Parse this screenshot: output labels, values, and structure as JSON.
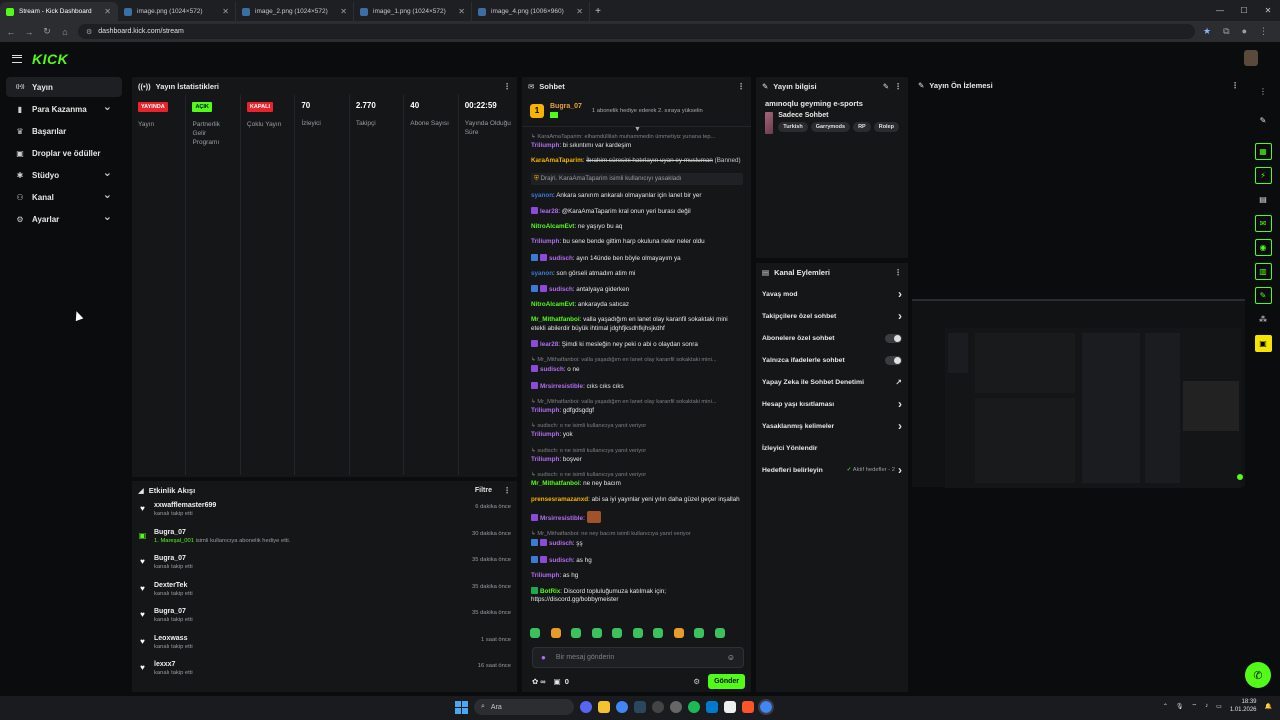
{
  "browser": {
    "tabs": [
      {
        "label": "Stream - Kick Dashboard",
        "active": true
      },
      {
        "label": "image.png (1024×572)"
      },
      {
        "label": "image_2.png (1024×572)"
      },
      {
        "label": "image_1.png (1024×572)"
      },
      {
        "label": "image_4.png (1006×960)"
      }
    ],
    "url": "dashboard.kick.com/stream"
  },
  "brand": {
    "logo": "KICK",
    "accent": "#53fc18"
  },
  "sidebar": {
    "items": [
      {
        "label": "Yayın",
        "icon": "broadcast-icon",
        "active": true
      },
      {
        "label": "Para Kazanma",
        "icon": "money-icon",
        "expandable": true
      },
      {
        "label": "Başarılar",
        "icon": "trophy-icon"
      },
      {
        "label": "Droplar ve ödüller",
        "icon": "gift-icon"
      },
      {
        "label": "Stüdyo",
        "icon": "studio-icon",
        "expandable": true
      },
      {
        "label": "Kanal",
        "icon": "channel-icon",
        "expandable": true
      },
      {
        "label": "Ayarlar",
        "icon": "gear-icon",
        "expandable": true
      }
    ]
  },
  "stats": {
    "title": "Yayın İstatistikleri",
    "columns": [
      {
        "badge": "YAYINDA",
        "badge_color": "red",
        "label": "Yayın"
      },
      {
        "badge": "AÇIK",
        "badge_color": "green",
        "label": "Partnerlik Gelir Programı"
      },
      {
        "badge": "KAPALI",
        "badge_color": "red",
        "label": "Çoklu Yayın"
      },
      {
        "value": "70",
        "label": "İzleyici"
      },
      {
        "value": "2.770",
        "label": "Takipçi"
      },
      {
        "value": "40",
        "label": "Abone Sayısı"
      },
      {
        "value": "00:22:59",
        "label": "Yayında Olduğu Süre"
      }
    ]
  },
  "activity": {
    "title": "Etkinlik Akışı",
    "filter_label": "Filtre",
    "items": [
      {
        "name": "xxwafflemaster699",
        "sub": "kanalı takip etti",
        "time": "6 dakika önce",
        "icon": "heart-icon"
      },
      {
        "name": "Bugra_07",
        "sub_highlight": "1. Mareşal_001",
        "sub": " isimli kullanıcıya abonelik hediye etti.",
        "time": "30 dakika önce",
        "icon": "gift-icon"
      },
      {
        "name": "Bugra_07",
        "sub": "kanalı takip etti",
        "time": "35 dakika önce",
        "icon": "heart-icon"
      },
      {
        "name": "DexterTek",
        "sub": "kanalı takip etti",
        "time": "35 dakika önce",
        "icon": "heart-icon"
      },
      {
        "name": "Bugra_07",
        "sub": "kanalı takip etti",
        "time": "35 dakika önce",
        "icon": "heart-icon"
      },
      {
        "name": "Leoxwass",
        "sub": "kanalı takip etti",
        "time": "1 saat önce",
        "icon": "heart-icon"
      },
      {
        "name": "lexxx7",
        "sub": "kanalı takip etti",
        "time": "16 saat önce",
        "icon": "heart-icon"
      }
    ]
  },
  "chat": {
    "title": "Sohbet",
    "pinned": {
      "user": "Bugra_07",
      "rank": "1",
      "text": "1 abonelik hediye ederek 2. sıraya yükselin"
    },
    "messages": [
      {
        "type": "reply",
        "text": "KaraAmaTaparim: elhamdüllilah muhammedin ümmetiyiz yunana tep..."
      },
      {
        "user": "Triliumph",
        "color": "#b26ef2",
        "text": "bi sıkıntımı var kardeşim"
      },
      {
        "user": "KaraAmaTaparim",
        "color": "#f4b400",
        "text": "İbrahim süresini hatırlayın uyan ey musluman",
        "strike": true,
        "suffix": " (Banned)"
      },
      {
        "type": "sys",
        "text": "Drajri. KaraAmaTaparim isimli kullanıcıyı yasakladı"
      },
      {
        "user": "syanon",
        "color": "#3a7bd5",
        "text": "Ankara sanırım ankaralı olmayanlar için lanet bir yer"
      },
      {
        "user": "lear28",
        "color": "#b26ef2",
        "badge": "p",
        "text": "@KaraAmaTaparim kral onun yeri burası değil"
      },
      {
        "user": "NitroAlcamEvt",
        "color": "#53fc18",
        "text": "ne yaşıyo bu aq"
      },
      {
        "user": "Triliumph",
        "color": "#b26ef2",
        "text": "bu sene bende gittim harp okuluna neler neler oldu"
      },
      {
        "user": "sudisch",
        "color": "#b26ef2",
        "badge": "b",
        "text": "ayın 14ünde ben böyle olmayayım ya"
      },
      {
        "user": "syanon",
        "color": "#3a7bd5",
        "text": "son görseli atmadım atim mi"
      },
      {
        "user": "sudisch",
        "color": "#b26ef2",
        "badge": "b",
        "text": "antalyaya giderken"
      },
      {
        "user": "NitroAlcamEvt",
        "color": "#53fc18",
        "text": "ankarayda satıcaz"
      },
      {
        "user": "Mr_Mithatfanboi",
        "color": "#53fc18",
        "text": "valla yaşadığım en lanet olay karanfil sokaktaki mini etekli abilerdir büyük ihtimal jdghfjksdhfkjhsjkdhf"
      },
      {
        "user": "lear28",
        "color": "#b26ef2",
        "badge": "p",
        "text": "Şimdi ki mesleğin ney peki o abi o olaydan sonra"
      },
      {
        "type": "reply",
        "text": "Mr_Mithatfanboi: valla yaşadığım en lanet olay karanfil sokaktaki mini..."
      },
      {
        "user": "sudisch",
        "color": "#b26ef2",
        "badge": "p",
        "text": "o ne"
      },
      {
        "user": "Mrsirresistible",
        "color": "#b26ef2",
        "badge": "p",
        "text": "cıks cıks cıks"
      },
      {
        "type": "reply",
        "text": "Mr_Mithatfanboi: valla yaşadığım en lanet olay karanfil sokaktaki mini..."
      },
      {
        "user": "Triliumph",
        "color": "#b26ef2",
        "text": "gdfgdsgdgf"
      },
      {
        "type": "reply",
        "text": "sudisch: o ne isimli kullanıcıya yanıt veriyor"
      },
      {
        "user": "Triliumph",
        "color": "#b26ef2",
        "text": "yok"
      },
      {
        "type": "reply",
        "text": "sudisch: o ne isimli kullanıcıya yanıt veriyor"
      },
      {
        "user": "Triliumph",
        "color": "#b26ef2",
        "text": "boşver"
      },
      {
        "type": "reply",
        "text": "sudisch: o ne isimli kullanıcıya yanıt veriyor"
      },
      {
        "user": "Mr_Mithatfanboi",
        "color": "#53fc18",
        "text": "ne ney bacım"
      },
      {
        "user": "prensesramazanxd",
        "color": "#f4b400",
        "text": "abi sa iyi yayınlar yeni yılın daha güzel geçer inşallah"
      },
      {
        "user": "Mrsirresistible",
        "color": "#b26ef2",
        "badge": "p",
        "text": ""
      },
      {
        "type": "reply",
        "text": "Mr_Mithatfanboi: ne ney bacım isimli kullanıcıya yanıt veriyor"
      },
      {
        "user": "sudisch",
        "color": "#b26ef2",
        "badge": "b",
        "text": "şş"
      },
      {
        "user": "sudisch",
        "color": "#b26ef2",
        "badge": "b",
        "text": "as hg"
      },
      {
        "user": "Triliumph",
        "color": "#b26ef2",
        "text": "as hg"
      },
      {
        "user": "BotRix",
        "color": "#53fc18",
        "badge": "g",
        "text": "Discord topluluğumuza katılmak için; https://discord.gg/bobbymeister"
      }
    ],
    "input_placeholder": "Bir mesaj gönderin",
    "send_label": "Gönder",
    "footer_count_a": "∞",
    "footer_count_b": "0"
  },
  "stream_info": {
    "title": "Yayın bilgisi",
    "stream_title": "amınoqlu geyming e-sports",
    "category": "Sadece Sohbet",
    "tags": [
      "Turkish",
      "Garrymods",
      "RP",
      "Rolep"
    ]
  },
  "channel_actions": {
    "title": "Kanal Eylemleri",
    "items": [
      {
        "label": "Yavaş mod",
        "control": "chevron"
      },
      {
        "label": "Takipçilere özel sohbet",
        "control": "chevron"
      },
      {
        "label": "Abonelere özel sohbet",
        "control": "toggle"
      },
      {
        "label": "Yalnızca ifadelerle sohbet",
        "control": "toggle"
      },
      {
        "label": "Yapay Zeka ile Sohbet Denetimi",
        "control": "external"
      },
      {
        "label": "Hesap yaşı kısıtlaması",
        "control": "chevron"
      },
      {
        "label": "Yasaklanmış kelimeler",
        "control": "chevron"
      },
      {
        "label": "İzleyici Yönlendir",
        "control": "none"
      },
      {
        "label": "Hedefleri belirleyin",
        "control": "chevron",
        "extra": "Aktif hedefler - 2"
      }
    ]
  },
  "preview": {
    "title": "Yayın Ön İzlemesi"
  },
  "taskbar": {
    "search_label": "Ara",
    "time": "18:39",
    "date": "1.01.2026"
  }
}
